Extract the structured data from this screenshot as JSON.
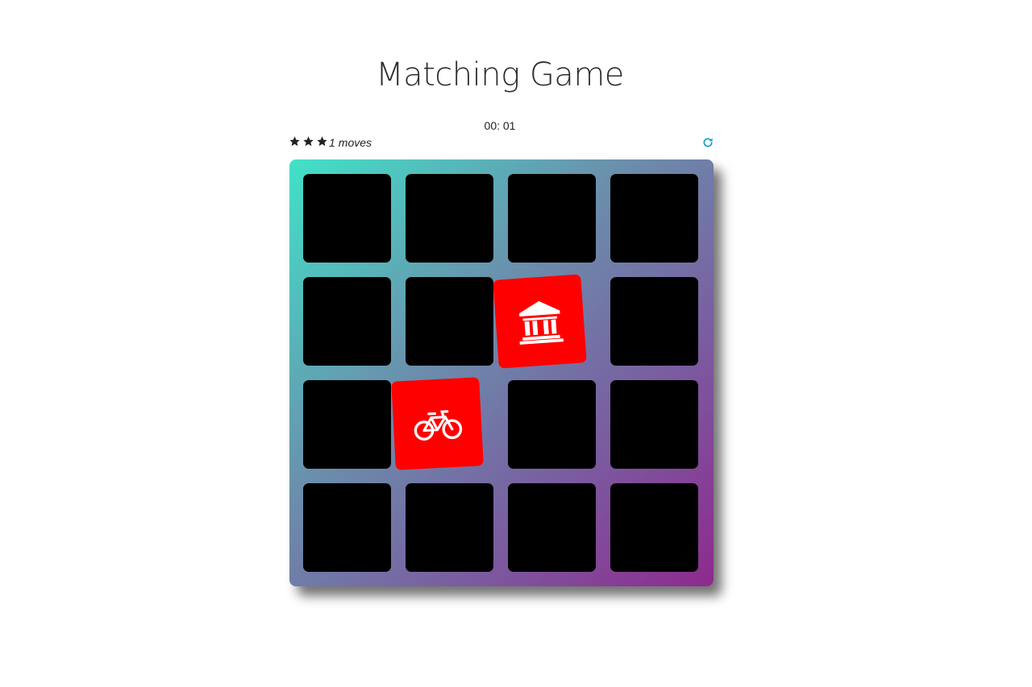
{
  "title": "Matching Game",
  "timer": "00: 01",
  "score": {
    "stars": 3,
    "moves_count": "1",
    "moves_label": "moves"
  },
  "restart": {
    "icon": "refresh-icon",
    "color": "#1a9fd0"
  },
  "deck": {
    "gradient": [
      "#41e2c8",
      "#6b8eac",
      "#7a5ca0",
      "#8e2a8e"
    ],
    "card_back_color": "#000000",
    "card_open_color": "#ff0000",
    "cards": [
      {
        "row": 1,
        "col": 1,
        "state": "closed"
      },
      {
        "row": 1,
        "col": 2,
        "state": "closed"
      },
      {
        "row": 1,
        "col": 3,
        "state": "closed"
      },
      {
        "row": 1,
        "col": 4,
        "state": "closed"
      },
      {
        "row": 2,
        "col": 1,
        "state": "closed"
      },
      {
        "row": 2,
        "col": 2,
        "state": "closed"
      },
      {
        "row": 2,
        "col": 3,
        "state": "open",
        "icon": "bank-icon"
      },
      {
        "row": 2,
        "col": 4,
        "state": "closed"
      },
      {
        "row": 3,
        "col": 1,
        "state": "closed"
      },
      {
        "row": 3,
        "col": 2,
        "state": "open",
        "icon": "bicycle-icon"
      },
      {
        "row": 3,
        "col": 3,
        "state": "closed"
      },
      {
        "row": 3,
        "col": 4,
        "state": "closed"
      },
      {
        "row": 4,
        "col": 1,
        "state": "closed"
      },
      {
        "row": 4,
        "col": 2,
        "state": "closed"
      },
      {
        "row": 4,
        "col": 3,
        "state": "closed"
      },
      {
        "row": 4,
        "col": 4,
        "state": "closed"
      }
    ]
  }
}
